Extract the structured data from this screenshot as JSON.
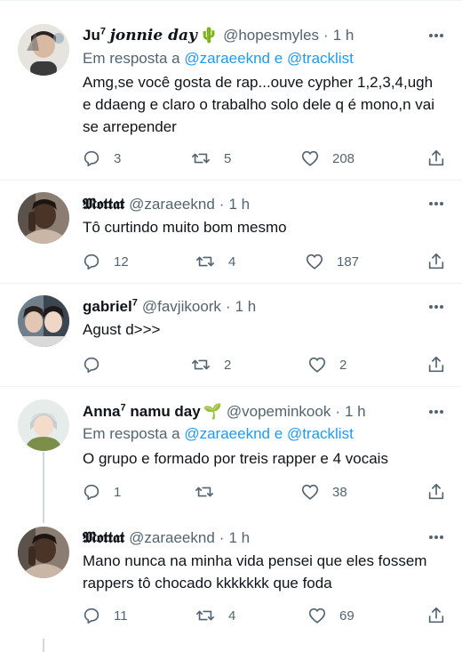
{
  "tweets": [
    {
      "name": "Ju",
      "name_sup": "7",
      "name_suffix": "jonnie day",
      "name_emoji": "🌵",
      "handle": "@hopesmyles",
      "dot": "·",
      "time": "1 h",
      "reply_prefix": "Em resposta a",
      "reply_user1": "@zaraeeknd",
      "reply_and": "e",
      "reply_user2": "@tracklist",
      "text": "Amg,se você gosta de rap...ouve cypher 1,2,3,4,ugh e ddaeng e claro o trabalho solo dele q é mono,n vai se arrepender",
      "replies": "3",
      "retweets": "5",
      "likes": "208"
    },
    {
      "name": "𝕸𝖔𝖙𝖙𝖆𝖙",
      "handle": "@zaraeeknd",
      "dot": "·",
      "time": "1 h",
      "text": "Tô curtindo muito bom mesmo",
      "replies": "12",
      "retweets": "4",
      "likes": "187"
    },
    {
      "name": "gabriel",
      "name_sup": "7",
      "handle": "@favjikoork",
      "dot": "·",
      "time": "1 h",
      "text": "Agust d>>>",
      "replies": "",
      "retweets": "2",
      "likes": "2"
    },
    {
      "name": "Anna",
      "name_sup": "7",
      "name_suffix": "namu day",
      "name_emoji": "🌱",
      "handle": "@vopeminkook",
      "dot": "·",
      "time": "1 h",
      "reply_prefix": "Em resposta a",
      "reply_user1": "@zaraeeknd",
      "reply_and": "e",
      "reply_user2": "@tracklist",
      "text": "O grupo e formado por treis rapper e 4 vocais",
      "replies": "1",
      "retweets": "",
      "likes": "38"
    },
    {
      "name": "𝕸𝖔𝖙𝖙𝖆𝖙",
      "handle": "@zaraeeknd",
      "dot": "·",
      "time": "1 h",
      "text": "Mano nunca na minha vida pensei que eles fossem rappers tô chocado kkkkkkk que foda",
      "replies": "11",
      "retweets": "4",
      "likes": "69"
    }
  ],
  "icons": {
    "reply": "reply-icon",
    "retweet": "retweet-icon",
    "like": "heart-icon",
    "share": "share-icon",
    "more": "more-dots-icon"
  },
  "colors": {
    "text": "#0f1419",
    "secondary": "#536471",
    "link": "#1d9bf0",
    "divider": "#eff3f4"
  }
}
